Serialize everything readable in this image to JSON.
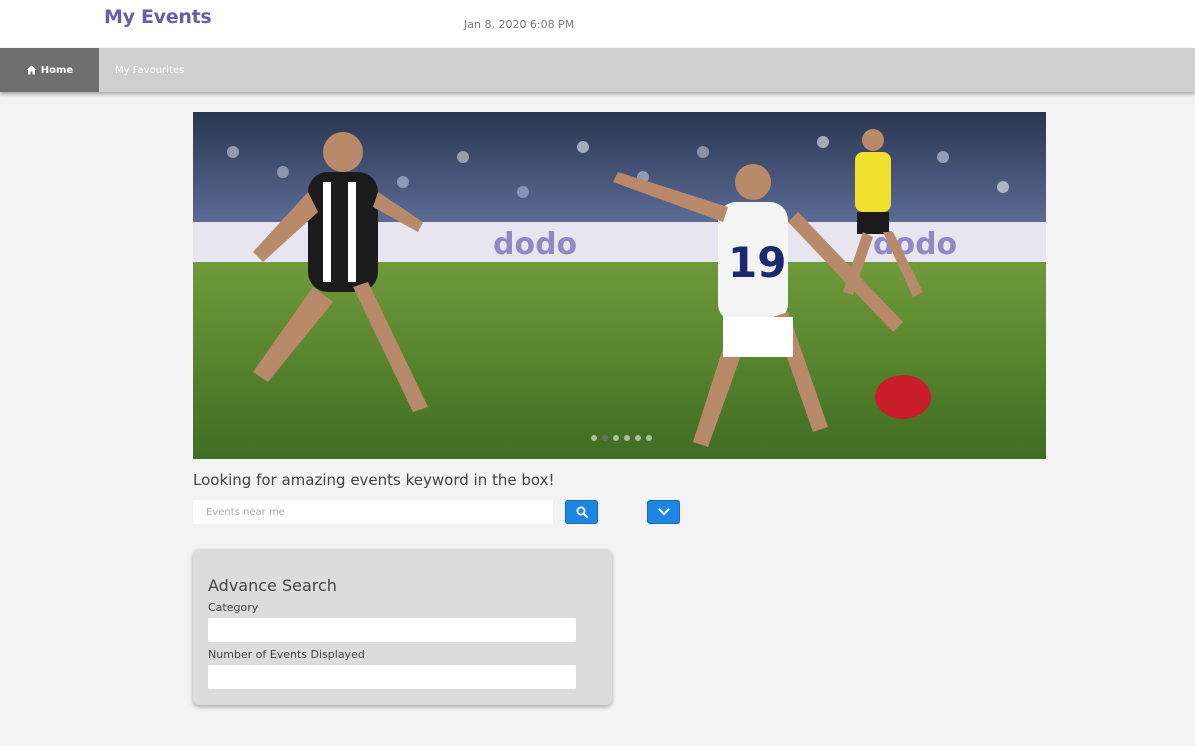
{
  "header": {
    "title": "My Events",
    "datetime": "Jan 8, 2020 6:08 PM"
  },
  "nav": {
    "home_label": "Home",
    "home_icon": "home-icon",
    "favourites_label": "My Favourites"
  },
  "carousel": {
    "image_icon": "sports-photo",
    "slide_count": 6,
    "active_slide": 2
  },
  "search": {
    "prompt": "Looking for amazing events keyword in the box!",
    "placeholder": "Events near me",
    "search_icon": "search-icon",
    "toggle_icon": "chevron-down-icon"
  },
  "advanced": {
    "title": "Advance Search",
    "category_label": "Category",
    "number_label": "Number of Events Displayed"
  },
  "colors": {
    "brand": "#6b5ea8",
    "button": "#1d86e3",
    "nav_active": "#6e6e6e",
    "nav_bar": "#cfcfcf"
  }
}
